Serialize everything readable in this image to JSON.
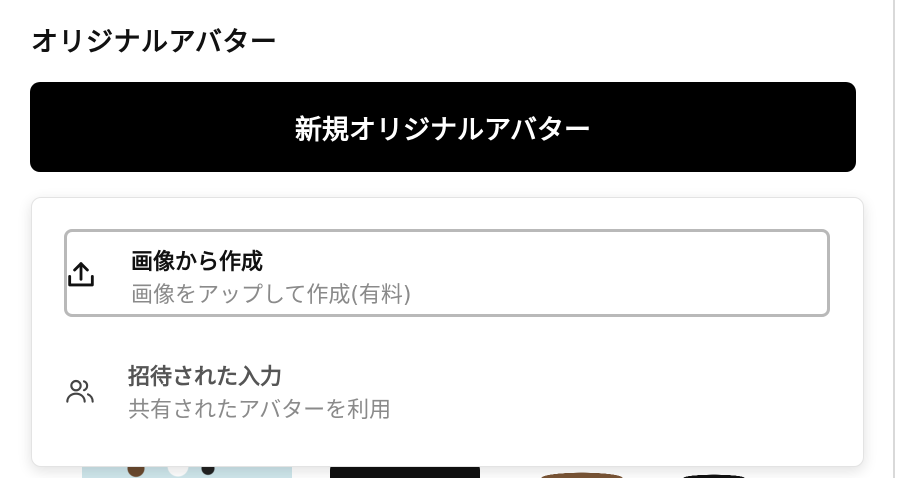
{
  "section": {
    "title": "オリジナルアバター"
  },
  "new_button": {
    "label": "新規オリジナルアバター"
  },
  "menu": {
    "items": [
      {
        "title": "画像から作成",
        "subtitle": "画像をアップして作成(有料)",
        "icon": "upload-icon"
      },
      {
        "title": "招待された入力",
        "subtitle": "共有されたアバターを利用",
        "icon": "users-icon"
      }
    ]
  },
  "colors": {
    "button_bg": "#000000",
    "button_text": "#ffffff",
    "subtitle": "#8a8a8a",
    "focus_border": "#b9b9b9"
  }
}
